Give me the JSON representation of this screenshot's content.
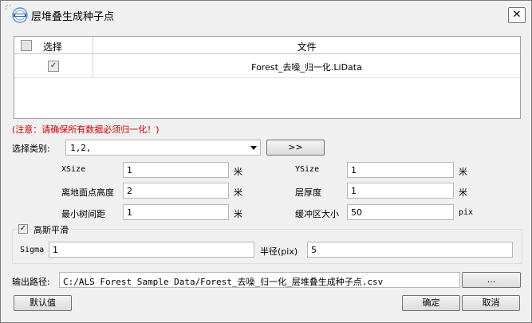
{
  "window": {
    "title": "层堆叠生成种子点",
    "close_symbol": "✕"
  },
  "table": {
    "header_select": "选择",
    "header_file": "文件",
    "rows": [
      {
        "checked": "✓",
        "file": "Forest_去噪_归一化.LiData"
      }
    ]
  },
  "notice": "(注意：请确保所有数据必须归一化！)",
  "category": {
    "label": "选择类别:",
    "value": "1,2,",
    "button": ">>"
  },
  "params": {
    "xsize_label": "XSize",
    "xsize_value": "1",
    "xsize_unit": "米",
    "ysize_label": "YSize",
    "ysize_value": "1",
    "ysize_unit": "米",
    "height_label": "离地面点高度",
    "height_value": "2",
    "height_unit": "米",
    "thickness_label": "层厚度",
    "thickness_value": "1",
    "thickness_unit": "米",
    "mindist_label": "最小树间距",
    "mindist_value": "1",
    "mindist_unit": "米",
    "buffer_label": "缓冲区大小",
    "buffer_value": "50",
    "buffer_unit": "pix"
  },
  "gauss": {
    "label": "高斯平滑",
    "checked": "✓",
    "sigma_label": "Sigma",
    "sigma_value": "1",
    "radius_label": "半径(pix)",
    "radius_value": "5"
  },
  "output": {
    "label": "输出路径:",
    "path": "C:/ALS Forest Sample Data/Forest_去噪_归一化_层堆叠生成种子点.csv",
    "browse": "..."
  },
  "buttons": {
    "default": "默认值",
    "ok": "确定",
    "cancel": "取消"
  }
}
